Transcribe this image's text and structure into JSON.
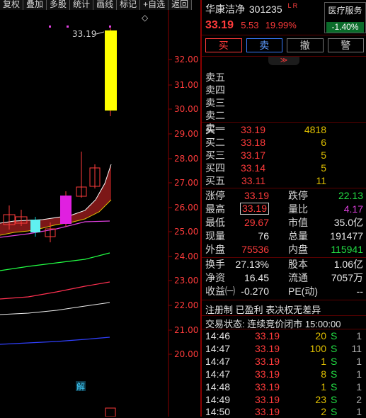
{
  "toolbar": {
    "buttons": [
      "复权",
      "叠加",
      "多股",
      "统计",
      "画线",
      "标记",
      "+自选",
      "返回"
    ]
  },
  "chart": {
    "price_labels": [
      "32.00",
      "31.00",
      "30.00",
      "29.00",
      "28.00",
      "27.00",
      "26.00",
      "25.00",
      "24.00",
      "23.00",
      "22.00",
      "21.00",
      "20.00"
    ],
    "high_label": "33.19",
    "diamond": "◇",
    "jie_marker": "解"
  },
  "stock": {
    "name": "华康洁净",
    "code": "301235",
    "flags": "L R",
    "price": "33.19",
    "change": "5.53",
    "pct": "19.99%",
    "sector_name": "医疗服务",
    "sector_change": "-1.40%"
  },
  "trade_buttons": [
    "买",
    "卖",
    "撤",
    "警"
  ],
  "collapse_icon": "≫",
  "ask": [
    {
      "label": "卖五",
      "price": "",
      "vol": ""
    },
    {
      "label": "卖四",
      "price": "",
      "vol": ""
    },
    {
      "label": "卖三",
      "price": "",
      "vol": ""
    },
    {
      "label": "卖二",
      "price": "",
      "vol": ""
    },
    {
      "label": "卖一",
      "price": "",
      "vol": ""
    }
  ],
  "bid": [
    {
      "label": "买一",
      "price": "33.19",
      "vol": "4818"
    },
    {
      "label": "买二",
      "price": "33.18",
      "vol": "6"
    },
    {
      "label": "买三",
      "price": "33.17",
      "vol": "5"
    },
    {
      "label": "买四",
      "price": "33.14",
      "vol": "5"
    },
    {
      "label": "买五",
      "price": "33.11",
      "vol": "11"
    }
  ],
  "quote": {
    "zt_label": "涨停",
    "zt": "33.19",
    "dt_label": "跌停",
    "dt": "22.13",
    "high_label": "最高",
    "high": "33.19",
    "lb_label": "量比",
    "lb": "4.17",
    "low_label": "最低",
    "low": "29.67",
    "sz_label": "市值",
    "sz": "35.0亿",
    "xl_label": "现量",
    "xl": "76",
    "zl_label": "总量",
    "zl": "191477",
    "wp_label": "外盘",
    "wp": "75536",
    "np_label": "内盘",
    "np": "115941",
    "hs_label": "换手",
    "hs": "27.13%",
    "gb_label": "股本",
    "gb": "1.06亿",
    "jz_label": "净资",
    "jz": "16.45",
    "lt_label": "流通",
    "lt": "7057万",
    "sy_label": "收益㈠",
    "sy": "-0.270",
    "pe_label": "PE(动)",
    "pe": "--"
  },
  "info": {
    "line1": "注册制 已盈利 表决权无差异",
    "line2": "交易状态: 连续竞价闭市 15:00:00"
  },
  "ticks": [
    {
      "t": "14:46",
      "p": "33.19",
      "v": "20",
      "d": "S",
      "n": "1"
    },
    {
      "t": "14:47",
      "p": "33.19",
      "v": "100",
      "d": "S",
      "n": "11"
    },
    {
      "t": "14:47",
      "p": "33.19",
      "v": "1",
      "d": "S",
      "n": "1"
    },
    {
      "t": "14:47",
      "p": "33.19",
      "v": "8",
      "d": "S",
      "n": "1"
    },
    {
      "t": "14:48",
      "p": "33.19",
      "v": "1",
      "d": "S",
      "n": "1"
    },
    {
      "t": "14:49",
      "p": "33.19",
      "v": "23",
      "d": "S",
      "n": "2"
    },
    {
      "t": "14:50",
      "p": "33.19",
      "v": "2",
      "d": "S",
      "n": "1"
    }
  ],
  "colors": {
    "up": "#ff3b3b",
    "down": "#22dd44",
    "vol": "#e0c000",
    "bg": "#000000"
  }
}
